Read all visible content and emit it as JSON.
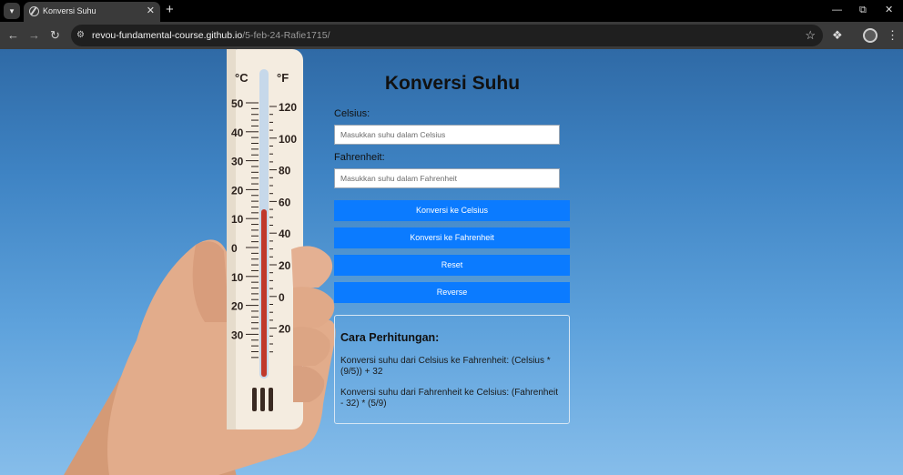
{
  "browser": {
    "tab": {
      "title": "Konversi Suhu"
    },
    "url": {
      "host": "revou-fundamental-course.github.io",
      "path": "/5-feb-24-Rafie1715/"
    }
  },
  "thermometer": {
    "celsius_symbol": "°C",
    "fahrenheit_symbol": "°F",
    "celsius_ticks": [
      "50",
      "40",
      "30",
      "20",
      "10",
      "0",
      "10",
      "20",
      "30"
    ],
    "fahrenheit_ticks": [
      "120",
      "100",
      "80",
      "60",
      "40",
      "20",
      "0",
      "20"
    ]
  },
  "page": {
    "title": "Konversi Suhu",
    "celsius": {
      "label": "Celsius:",
      "placeholder": "Masukkan suhu dalam Celsius",
      "value": ""
    },
    "fahrenheit": {
      "label": "Fahrenheit:",
      "placeholder": "Masukkan suhu dalam Fahrenheit",
      "value": ""
    },
    "buttons": {
      "to_celsius": "Konversi ke Celsius",
      "to_fahrenheit": "Konversi ke Fahrenheit",
      "reset": "Reset",
      "reverse": "Reverse"
    },
    "explanation": {
      "title": "Cara Perhitungan:",
      "line1": "Konversi suhu dari Celsius ke Fahrenheit: (Celsius * (9/5)) + 32",
      "line2": "Konversi suhu dari Fahrenheit ke Celsius: (Fahrenheit - 32) * (5/9)"
    }
  },
  "colors": {
    "button": "#0b7bff",
    "sky": "#3f84c4",
    "mercury": "#c0392b"
  }
}
